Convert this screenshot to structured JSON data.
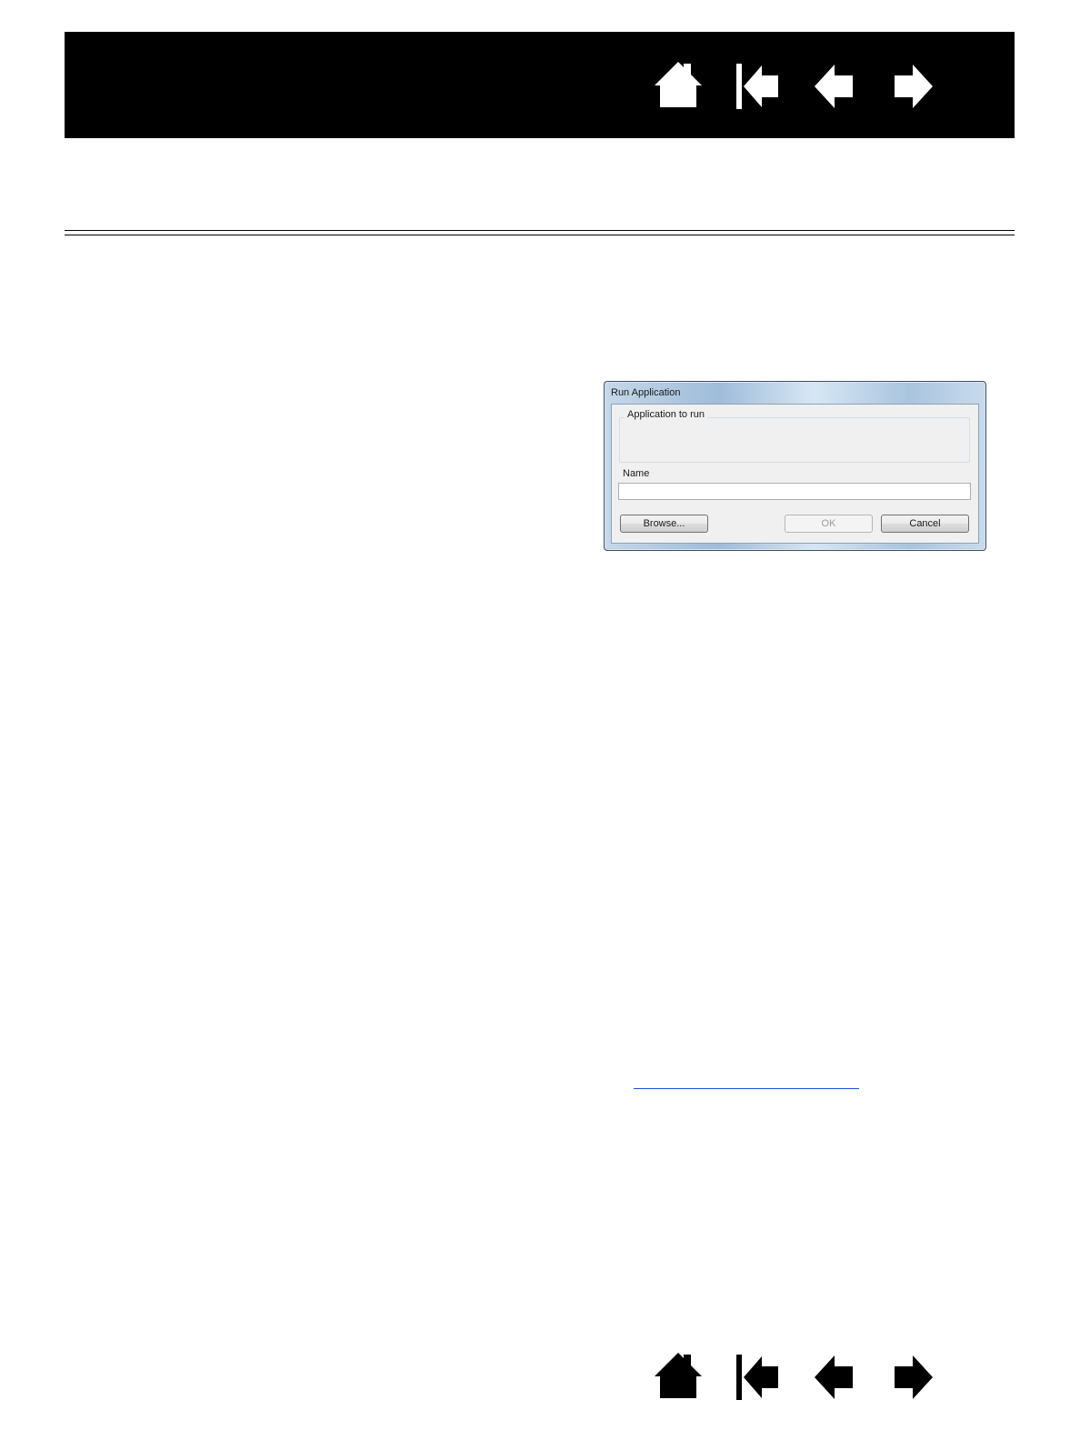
{
  "nav": {
    "icons": [
      "home-icon",
      "first-page-icon",
      "previous-page-icon",
      "next-page-icon"
    ]
  },
  "dialog": {
    "title": "Run Application",
    "group_label": "Application to run",
    "name_label": "Name",
    "name_value": "",
    "buttons": {
      "browse": "Browse...",
      "ok": "OK",
      "cancel": "Cancel"
    }
  },
  "colors": {
    "header": "#000000",
    "link": "#1a4fd6"
  }
}
